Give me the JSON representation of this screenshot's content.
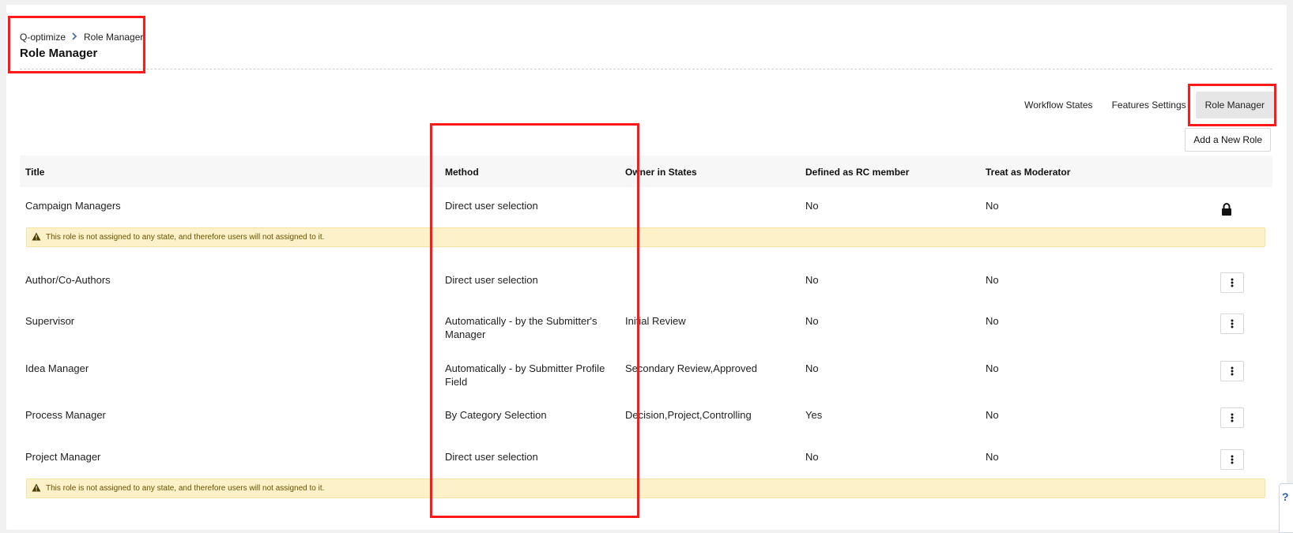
{
  "breadcrumb": {
    "root": "Q-optimize",
    "current": "Role Manager"
  },
  "page_title": "Role Manager",
  "tabs": [
    {
      "label": "Workflow States"
    },
    {
      "label": "Features Settings"
    },
    {
      "label": "Role Manager",
      "active": true
    }
  ],
  "add_role_label": "Add a New Role",
  "table": {
    "headers": {
      "title": "Title",
      "method": "Method",
      "owner": "Owner in States",
      "rc": "Defined as RC member",
      "moderator": "Treat as Moderator"
    },
    "rows": [
      {
        "title": "Campaign Managers",
        "method": "Direct user selection",
        "owner": "",
        "rc": "No",
        "moderator": "No",
        "locked": true
      },
      {
        "title": "Author/Co-Authors",
        "method": "Direct user selection",
        "owner": "",
        "rc": "No",
        "moderator": "No"
      },
      {
        "title": "Supervisor",
        "method": "Automatically - by the Submitter's Manager",
        "owner": "Initial Review",
        "rc": "No",
        "moderator": "No"
      },
      {
        "title": "Idea Manager",
        "method": "Automatically - by Submitter Profile Field",
        "owner": "Secondary Review,Approved",
        "rc": "No",
        "moderator": "No"
      },
      {
        "title": "Process Manager",
        "method": "By Category Selection",
        "owner": "Decision,Project,Controlling",
        "rc": "Yes",
        "moderator": "No"
      },
      {
        "title": "Project Manager",
        "method": "Direct user selection",
        "owner": "",
        "rc": "No",
        "moderator": "No"
      }
    ]
  },
  "warning_text": "This role is not assigned to any state, and therefore users will not assigned to it.",
  "help_glyph": "?",
  "colors": {
    "highlight": "#ff1a1a",
    "warning_bg": "#fdf1c9",
    "tab_active_bg": "#e6e6e6"
  }
}
